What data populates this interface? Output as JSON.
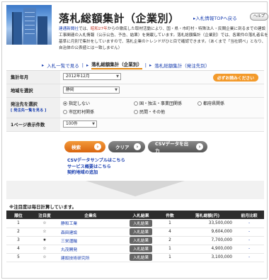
{
  "header": {
    "title": "落札総額集計（企業別）",
    "top_link": "入札情報TOPへ戻る",
    "help": "ヘルプ",
    "intro_parts": [
      {
        "t": "建通新聞社",
        "cls": "hl"
      },
      {
        "t": "では、",
        "cls": ""
      },
      {
        "t": "昭和27年",
        "cls": "red"
      },
      {
        "t": "からの徹底した取材活動により、国・県・市町村・特殊法人・民間企業に到るまでの建設工事関連の入札情報（公示公告、予告、結果）を掲載しています。落札総額集計（企業別）では、各案件の落札者名を基準に月別で集計をしていますので、落札企業のトレンドがひと目で確認できます。（あくまで「当社調べ」となり、自治体の公表値とは一致しません）",
        "cls": ""
      }
    ]
  },
  "subnav": {
    "items": [
      "入札一覧で見る",
      "落札総額集計（企業別）",
      "落札総額集計（発注先別）"
    ]
  },
  "form": {
    "year_month_label": "集計年月",
    "year_month_value": "2012年12月",
    "required_badge": "必ずお読みください",
    "region_label": "地域を選択",
    "region_value": "静岡",
    "orderer_label": "発注先を選択",
    "orderer_sublabel": "[ 発注先一覧を見る ]",
    "radios": [
      {
        "label": "指定しない",
        "on": true
      },
      {
        "label": "国・独法・事業団関係",
        "on": false
      },
      {
        "label": "都府県関係",
        "on": false
      },
      {
        "label": "市区町村関係",
        "on": false
      },
      {
        "label": "民間・その他",
        "on": false
      }
    ],
    "per_page_label": "1ページ表示件数",
    "per_page_value": "100件"
  },
  "buttons": {
    "search": "検索",
    "clear": "クリア",
    "csv": "CSVデータを出力"
  },
  "links": [
    "CSVデータサンプルはこちら",
    "サービス概要はこちら",
    "契約地域の追加"
  ],
  "note": "※注目度は毎日計算しています。",
  "table": {
    "headers": [
      "順位",
      "注目度",
      "企業名",
      "入札結果",
      "件数",
      "落札総額(円)",
      "前月比較"
    ],
    "rows": [
      {
        "rank": "1",
        "star": "☆",
        "company": "静和工業",
        "result": "入札結果",
        "count": "1",
        "total": "33,500,000",
        "change": "-"
      },
      {
        "rank": "2",
        "star": "☆",
        "company": "森田建設",
        "result": "入札結果",
        "count": "4",
        "total": "9,604,000",
        "change": "-"
      },
      {
        "rank": "3",
        "star": "★",
        "company": "三栄運輸",
        "result": "入札結果",
        "count": "2",
        "total": "7,700,000",
        "change": "-"
      },
      {
        "rank": "4",
        "star": "☆",
        "company": "丸茂開発",
        "result": "入札結果",
        "count": "1",
        "total": "4,900,000",
        "change": "-"
      },
      {
        "rank": "5",
        "star": "☆",
        "company": "建設技術研究所",
        "result": "入札結果",
        "count": "1",
        "total": "3,100,000",
        "change": "-"
      }
    ]
  }
}
